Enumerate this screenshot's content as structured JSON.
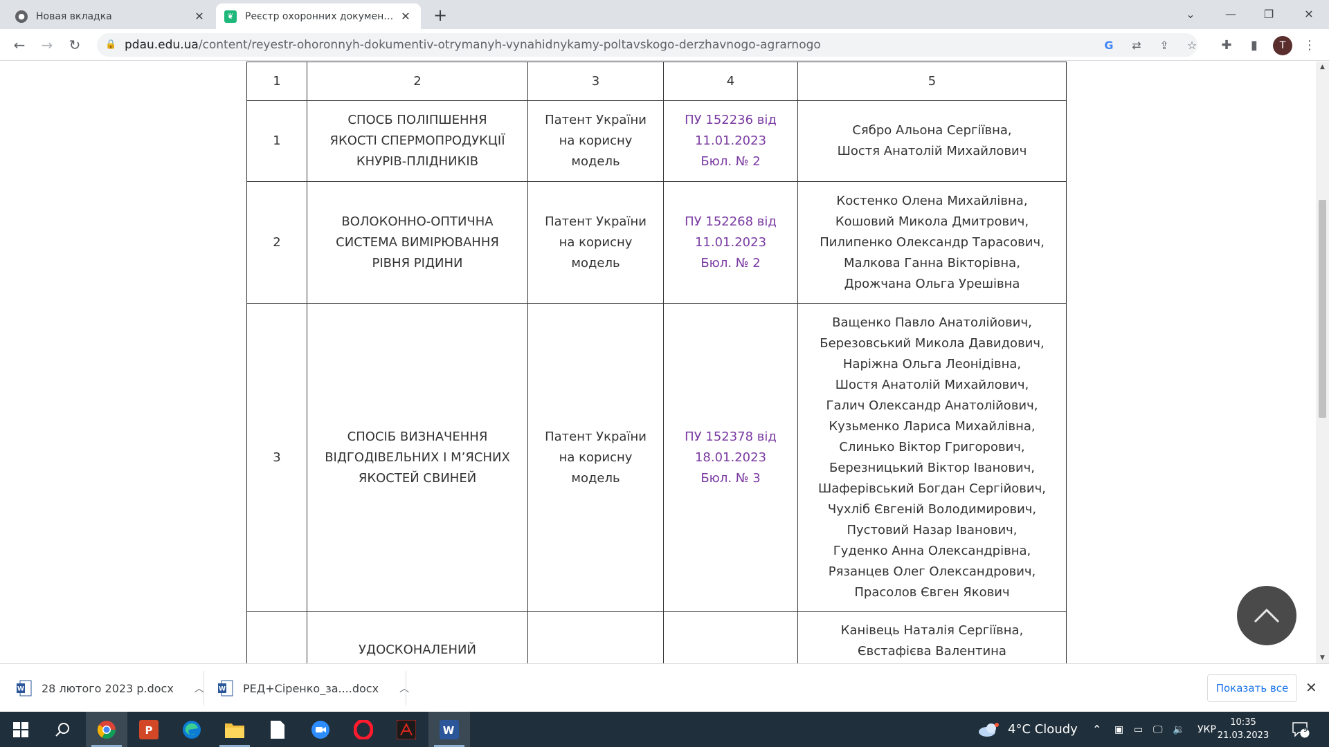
{
  "browser": {
    "tabs": [
      {
        "title": "Новая вкладка",
        "active": false
      },
      {
        "title": "Реєстр охоронних документів, о",
        "active": true
      }
    ],
    "url_host": "pdau.edu.ua",
    "url_path": "/content/reyestr-ohoronnyh-dokumentiv-otrymanyh-vynahidnykamy-poltavskogo-derzhavnogo-agrarnogo",
    "profile_initial": "T"
  },
  "table": {
    "header": [
      "1",
      "2",
      "3",
      "4",
      "5"
    ],
    "rows": [
      {
        "num": "1",
        "title": [
          "СПОСБ ПОЛІПШЕННЯ",
          "ЯКОСТІ СПЕРМОПРОДУКЦІЇ",
          "КНУРІВ-ПЛІДНИКІВ"
        ],
        "type": [
          "Патент України",
          "на корисну",
          "модель"
        ],
        "doc": [
          "ПУ 152236 від",
          "11.01.2023",
          "Бюл. № 2"
        ],
        "authors": [
          "Сябро Альона Сергіївна,",
          "Шостя Анатолій Михайлович"
        ]
      },
      {
        "num": "2",
        "title": [
          "ВОЛОКОННО-ОПТИЧНА",
          "СИСТЕМА ВИМІРЮВАННЯ",
          "РІВНЯ РІДИНИ"
        ],
        "type": [
          "Патент України",
          "на корисну",
          "модель"
        ],
        "doc": [
          "ПУ 152268 від",
          "11.01.2023",
          "Бюл. № 2"
        ],
        "authors": [
          "Костенко Олена Михайлівна,",
          "Кошовий Микола Дмитрович,",
          "Пилипенко Олександр Тарасович,",
          "Малкова Ганна Вікторівна,",
          "Дрожчана Ольга Урешівна"
        ]
      },
      {
        "num": "3",
        "title": [
          "СПОСІБ ВИЗНАЧЕННЯ",
          "ВІДГОДІВЕЛЬНИХ І М’ЯСНИХ",
          "ЯКОСТЕЙ СВИНЕЙ"
        ],
        "type": [
          "Патент України",
          "на корисну",
          "модель"
        ],
        "doc": [
          "ПУ 152378 від",
          "18.01.2023",
          "Бюл. № 3"
        ],
        "authors": [
          "Ващенко Павло Анатолійович,",
          "Березовський Микола Давидович,",
          "Наріжна Ольга Леонідівна,",
          "Шостя Анатолій Михайлович,",
          "Галич Олександр Анатолійович,",
          "Кузьменко Лариса Михайлівна,",
          "Слинько Віктор Григорович,",
          "Березницький Віктор Іванович,",
          "Шаферівський Богдан Сергійович,",
          "Чухліб Євгеній Володимирович,",
          "Пустовий Назар Іванович,",
          "Гуденко Анна Олександрівна,",
          "Рязанцев Олег Олександрович,",
          "Прасолов Євген Якович"
        ]
      },
      {
        "num": "",
        "title": [
          "УДОСКОНАЛЕНИЙ"
        ],
        "type": [],
        "doc": [],
        "authors": [
          "Канівець Наталія Сергіївна,",
          "Євстафієва Валентина"
        ]
      }
    ]
  },
  "downloads": {
    "items": [
      "28 лютого 2023 р.docx",
      "РЕД+Сіренко_за....docx"
    ],
    "show_all": "Показать все"
  },
  "taskbar": {
    "weather": "4°C  Cloudy",
    "language": "УКР",
    "time": "10:35",
    "date": "21.03.2023",
    "notifications": "9"
  },
  "colors": {
    "doc_link": "#7a3aa2",
    "taskbar": "#1f2f3b"
  }
}
